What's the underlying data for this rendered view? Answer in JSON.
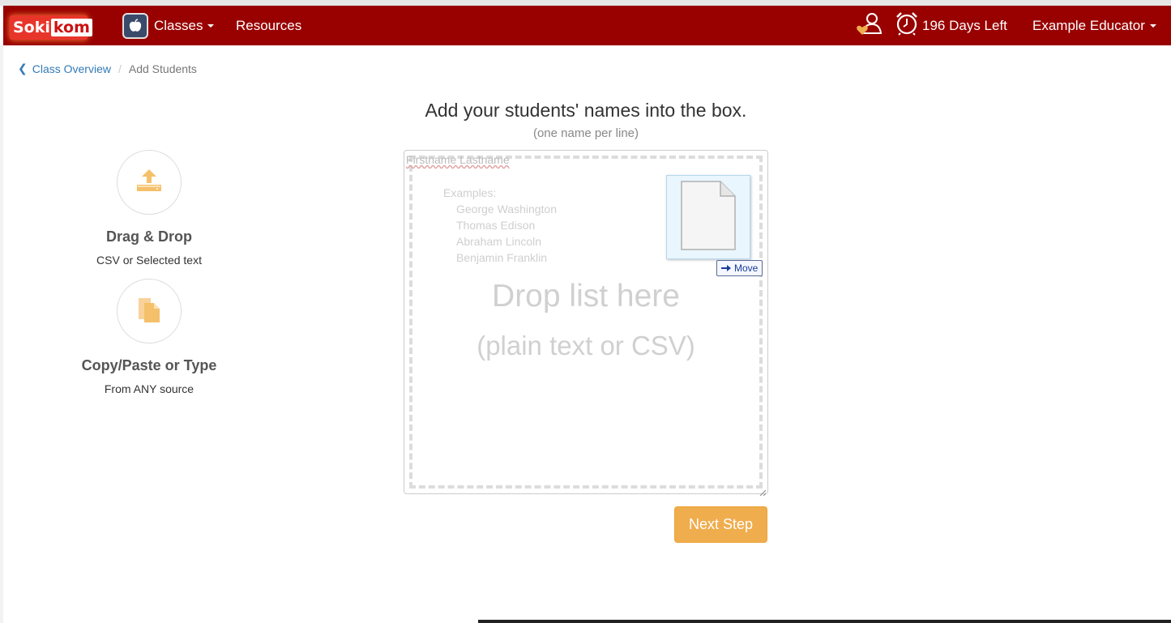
{
  "navbar": {
    "logo_part1": "Soki",
    "logo_part2": "kom",
    "classes_label": "Classes",
    "resources_label": "Resources",
    "days_left": "196 Days Left",
    "user_name": "Example Educator"
  },
  "breadcrumb": {
    "back_label": "Class Overview",
    "current": "Add Students"
  },
  "features": [
    {
      "icon": "upload-icon",
      "title": "Drag & Drop",
      "subtitle": "CSV or Selected text"
    },
    {
      "icon": "copy-icon",
      "title": "Copy/Paste or Type",
      "subtitle": "From ANY source"
    }
  ],
  "main": {
    "heading": "Add your students' names into the box.",
    "subheading": "(one name per line)",
    "placeholder": "Firstname Lastname",
    "examples_label": "Examples:",
    "examples": [
      "George Washington",
      "Thomas Edison",
      "Abraham Lincoln",
      "Benjamin Franklin"
    ],
    "drop_title": "Drop list here",
    "drop_sub": "(plain text or CSV)",
    "move_label": "Move",
    "next_button": "Next Step"
  },
  "colors": {
    "navbar": "#990000",
    "accent": "#f0ad4e",
    "icon": "#f5c06a",
    "link": "#337ab7"
  }
}
